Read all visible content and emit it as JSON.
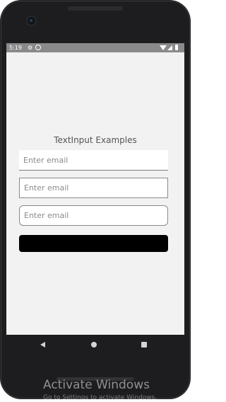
{
  "status_bar": {
    "time": "5:19"
  },
  "screen": {
    "title": "TextInput Examples",
    "inputs": [
      {
        "placeholder": "Enter email",
        "value": ""
      },
      {
        "placeholder": "Enter email",
        "value": ""
      },
      {
        "placeholder": "Enter email",
        "value": ""
      }
    ],
    "button": {
      "label": "",
      "color": "#000000"
    },
    "background": "#f2f2f2"
  },
  "navigation": {
    "icons": [
      "back-icon",
      "home-icon",
      "recents-icon"
    ]
  },
  "watermark": {
    "title": "Activate Windows",
    "subtitle": "Go to Settings to activate Windows."
  }
}
